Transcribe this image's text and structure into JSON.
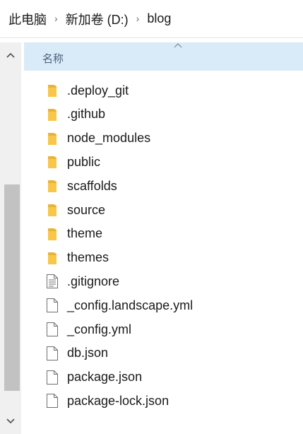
{
  "breadcrumb": {
    "items": [
      "此电脑",
      "新加卷 (D:)",
      "blog"
    ],
    "separator": "›"
  },
  "column_header": {
    "name_label": "名称",
    "sorted": "ascending"
  },
  "scrollbar": {
    "up_arrow": "^",
    "down_arrow": "v"
  },
  "files": [
    {
      "name": ".deploy_git",
      "type": "folder"
    },
    {
      "name": ".github",
      "type": "folder"
    },
    {
      "name": "node_modules",
      "type": "folder"
    },
    {
      "name": "public",
      "type": "folder"
    },
    {
      "name": "scaffolds",
      "type": "folder"
    },
    {
      "name": "source",
      "type": "folder"
    },
    {
      "name": "theme",
      "type": "folder"
    },
    {
      "name": "themes",
      "type": "folder"
    },
    {
      "name": ".gitignore",
      "type": "text-file"
    },
    {
      "name": "_config.landscape.yml",
      "type": "file"
    },
    {
      "name": "_config.yml",
      "type": "file"
    },
    {
      "name": "db.json",
      "type": "file"
    },
    {
      "name": "package.json",
      "type": "file"
    },
    {
      "name": "package-lock.json",
      "type": "file"
    }
  ],
  "colors": {
    "header_bg": "#d9ebf9",
    "folder_yellow": "#f8c74a",
    "scrollbar_track": "#f0f0f0",
    "scrollbar_thumb": "#c2c2c2"
  }
}
